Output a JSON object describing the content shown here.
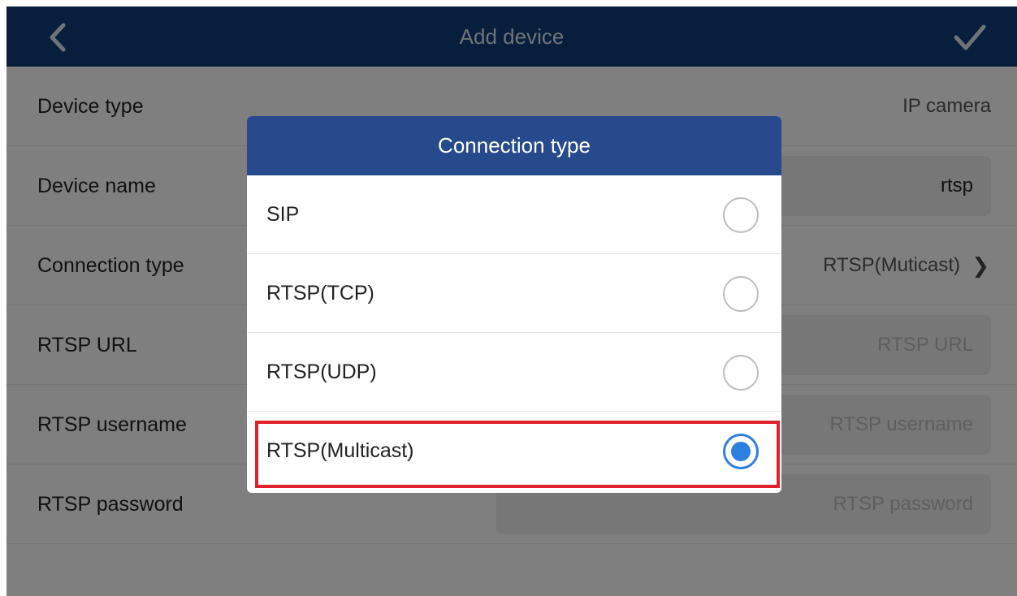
{
  "header": {
    "back_icon": "chevron-left-icon",
    "title": "Add device",
    "confirm_icon": "checkmark-icon"
  },
  "form": {
    "device_type": {
      "label": "Device type",
      "value": "IP camera"
    },
    "device_name": {
      "label": "Device name",
      "value": "rtsp"
    },
    "connection_type": {
      "label": "Connection type",
      "value": "RTSP(Muticast)",
      "icon": "chevron-right-icon"
    },
    "rtsp_url": {
      "label": "RTSP URL",
      "placeholder": "RTSP URL"
    },
    "rtsp_username": {
      "label": "RTSP username",
      "placeholder": "RTSP username"
    },
    "rtsp_password": {
      "label": "RTSP password",
      "placeholder": "RTSP password"
    }
  },
  "dialog": {
    "title": "Connection type",
    "options": [
      {
        "label": "SIP",
        "selected": false
      },
      {
        "label": "RTSP(TCP)",
        "selected": false
      },
      {
        "label": "RTSP(UDP)",
        "selected": false
      },
      {
        "label": "RTSP(Multicast)",
        "selected": true
      }
    ]
  },
  "colors": {
    "header_bg": "#0e3d78",
    "dialog_header_bg": "#274a8c",
    "radio_selected": "#2d7fe0",
    "highlight_border": "#e0202a"
  }
}
